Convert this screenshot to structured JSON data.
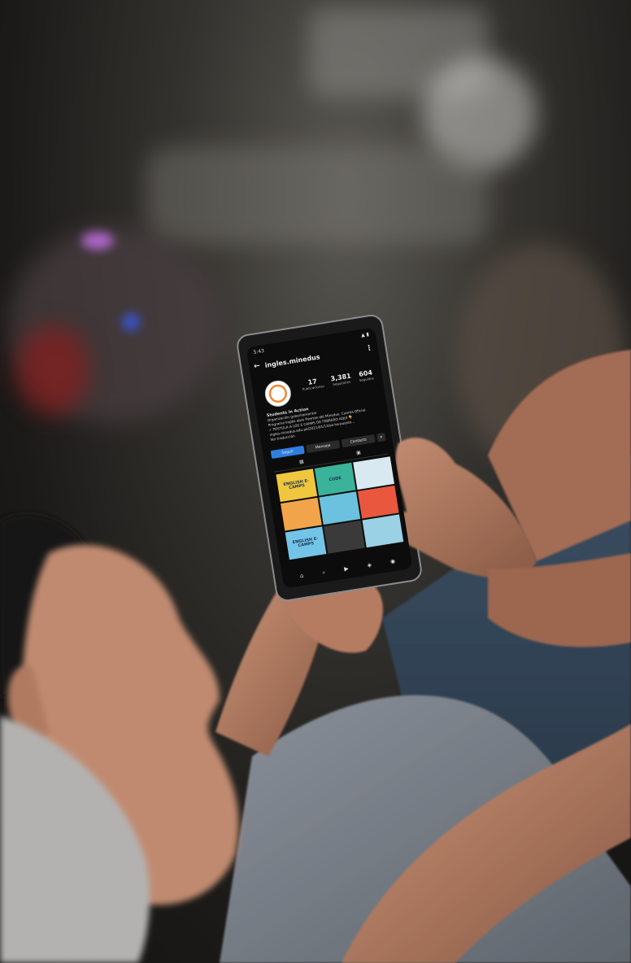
{
  "phone": {
    "status_time": "5:43",
    "status_icons": "▲ ▮",
    "username": "ingles.minedus",
    "stats": [
      {
        "num": "17",
        "label": "Publicaciones"
      },
      {
        "num": "3,381",
        "label": "Seguidores"
      },
      {
        "num": "604",
        "label": "Seguidos"
      }
    ],
    "bio_name": "Students in Action",
    "bio_lines": [
      "Organización gubernamental",
      "Programa Inglés abre Puertas del Minedus. Cuenta Oficial.",
      "✓ POSTULA A LOS E CAMPS DE FEBRERO AQUÍ 👇",
      "ingles.minedus.edu.pe/2021/01/13/se-ha-puesto...",
      "Ver traducción"
    ],
    "buttons": {
      "follow": "Seguir",
      "message": "Mensaje",
      "contact": "Contacto",
      "more": "▾"
    },
    "tabs": [
      "▦",
      "▣"
    ],
    "tiles": [
      {
        "text": "ENGLISH E-CAMPS",
        "color": "#f1c63f"
      },
      {
        "text": "CODE",
        "color": "#3bb39a"
      },
      {
        "text": "",
        "color": "#d9e9f2"
      },
      {
        "text": "",
        "color": "#f2a44a"
      },
      {
        "text": "",
        "color": "#6ac2df"
      },
      {
        "text": "",
        "color": "#e9573f"
      },
      {
        "text": "ENGLISH E-CAMPS",
        "color": "#74c4e8"
      },
      {
        "text": "",
        "color": "#3a3a3a"
      },
      {
        "text": "",
        "color": "#9ad1e5"
      }
    ],
    "nav_icons": [
      "⌂",
      "⌕",
      "▶",
      "◈",
      "◉"
    ]
  }
}
